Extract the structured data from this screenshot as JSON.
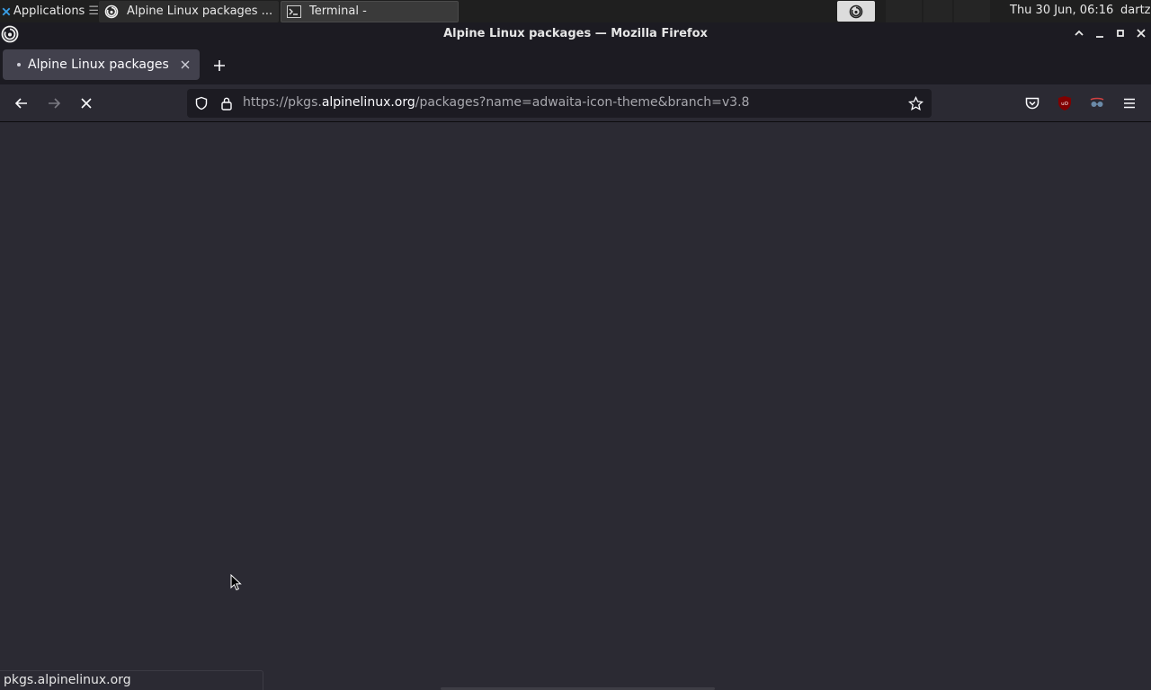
{
  "panel": {
    "applications_label": "Applications",
    "applications_sep": "☰",
    "tasks": [
      {
        "label": "Alpine Linux packages ...",
        "icon": "firefox-icon",
        "active": true
      },
      {
        "label": "Terminal -",
        "icon": "terminal-icon",
        "active": false
      }
    ],
    "clock": "Thu 30 Jun, 06:16",
    "user": "dartz"
  },
  "window": {
    "title": "Alpine Linux packages — Mozilla Firefox"
  },
  "tabs": [
    {
      "label": "Alpine Linux packages",
      "loading": true
    }
  ],
  "navbar": {
    "url_scheme": "https://pkgs.",
    "url_host": "alpinelinux.org",
    "url_path": "/packages?name=adwaita-icon-theme&branch=v3.8"
  },
  "status": {
    "text": "pkgs.alpinelinux.org"
  },
  "colors": {
    "content_bg": "#2b2a33",
    "toolbar_bg": "#1c1b22",
    "tab_active_bg": "#42414d",
    "ublock_red": "#800000"
  }
}
